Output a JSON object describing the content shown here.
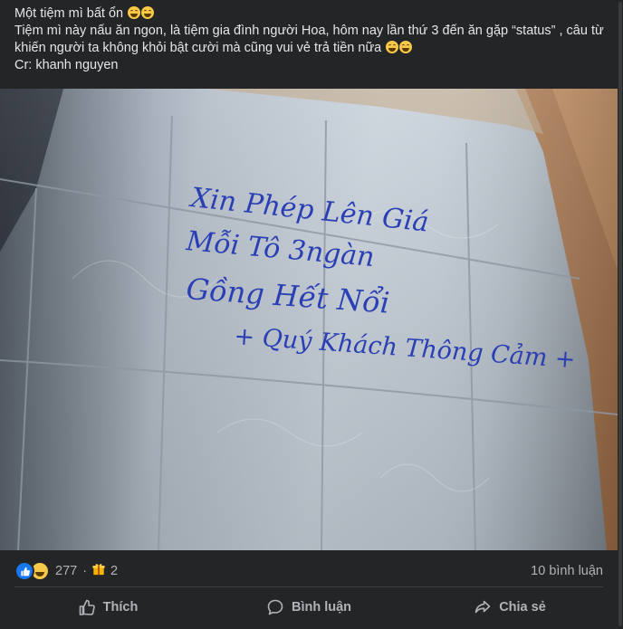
{
  "post": {
    "line1": "Một tiệm mì bất ổn",
    "line2": "Tiệm mì này nấu ăn ngon, là tiệm gia đình người Hoa, hôm nay lần thứ 3 đến ăn gặp “status” , câu từ khiến người ta không khỏi bật cười mà cũng vui vẻ trả tiền nữa",
    "line3": "Cr: khanh nguyen",
    "emoji": "grinning-squinting-face"
  },
  "photo": {
    "handwriting": {
      "line1": "Xin Phép Lên Giá",
      "line2": "Mỗi Tô 3ngàn",
      "line3": "Gồng Hết Nổi",
      "line4": "+ Quý Khách Thông Cảm +"
    },
    "ink_color": "#2a3fb4"
  },
  "reactions": {
    "count": "277",
    "gifts": "2",
    "comments": "10 bình luận",
    "separator": "·",
    "icons": [
      "like-icon",
      "haha-icon"
    ]
  },
  "actions": {
    "like": "Thích",
    "comment": "Bình luận",
    "share": "Chia sẻ"
  },
  "colors": {
    "background": "#242526",
    "text": "#e4e6eb",
    "secondary_text": "#b0b3b8",
    "like_blue": "#1877f2"
  }
}
